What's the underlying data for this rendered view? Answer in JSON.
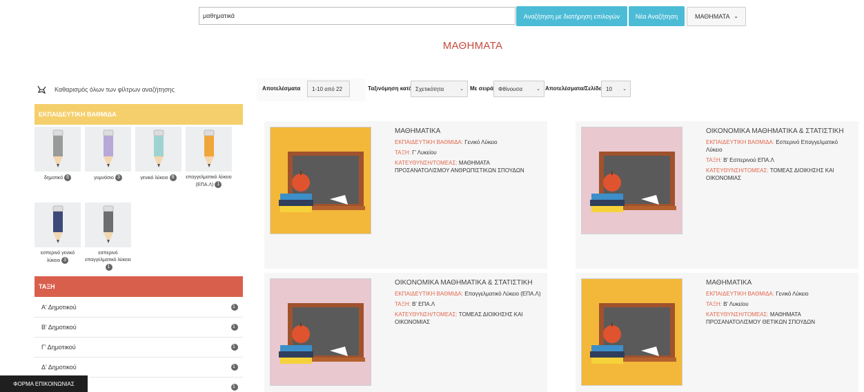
{
  "search": {
    "value": "μαθηματικά",
    "keep_options_label": "Αναζήτηση με διατήρηση επιλογών",
    "new_search_label": "Νέα Αναζήτηση",
    "category_selected": "ΜΑΘΗΜΑΤΑ"
  },
  "page_title": "ΜΑΘΗΜΑΤΑ",
  "sidebar": {
    "clear_filters_label": "Καθαρισμός όλων των φίλτρων αναζήτησης",
    "grade_panel_title": "ΕΚΠΑΙΔΕΥΤΙΚΗ ΒΑΘΜΙΔΑ",
    "grades": [
      {
        "label": "δημοτικό",
        "count": "6",
        "color": "#9a9a9a"
      },
      {
        "label": "γυμνάσιο",
        "count": "3",
        "color": "#b7a8d8"
      },
      {
        "label": "γενικό λύκειο",
        "count": "8",
        "color": "#9fd3cf"
      },
      {
        "label": "επαγγελματικό λύκειο (ΕΠΑ.Λ)",
        "count": "1",
        "color": "#f0a63a"
      },
      {
        "label": "εσπερινό γενικό λύκειο",
        "count": "3",
        "color": "#3d4a78"
      },
      {
        "label": "εσπερινό επαγγελματικό λύκειο",
        "count": "1",
        "color": "#6e6e6e"
      }
    ],
    "class_panel_title": "ΤΑΞΗ",
    "classes": [
      {
        "label": "Α' Δημοτικού",
        "count": "1"
      },
      {
        "label": "Β' Δημοτικού",
        "count": "1"
      },
      {
        "label": "Γ' Δημοτικού",
        "count": "1"
      },
      {
        "label": "Δ' Δημοτικού",
        "count": "1"
      },
      {
        "label": "",
        "count": "1"
      }
    ],
    "contact_label": "ΦΟΡΜΑ ΕΠΙΚΟΙΝΩΝΙΑΣ"
  },
  "toolbar": {
    "results_label": "Αποτελέσματα",
    "results_range": "1-10 από 22",
    "sort_label": "Ταξινόμηση κατά",
    "sort_value": "Σχετικότητα",
    "order_label": "Με σειρά",
    "order_value": "Φθίνουσα",
    "per_page_label": "Αποτελέσματα/Σελίδα",
    "per_page_value": "10"
  },
  "results": [
    {
      "title": "ΜΑΘΗΜΑΤΙΚΑ",
      "grade_label": "ΕΚΠΑΙΔΕΥΤΙΚΗ ΒΑΘΜΙΔΑ:",
      "grade_value": "Γενικό Λύκειο",
      "class_label": "ΤΑΞΗ:",
      "class_value": "Γ' Λυκείου",
      "dir_label": "ΚΑΤΕΥΘΥΝΣΗ/ΤΟΜΕΑΣ:",
      "dir_value": "ΜΑΘΗΜΑΤΑ ΠΡΟΣΑΝΑΤΟΛΙΣΜΟΥ ΑΝΘΡΩΠΙΣΤΙΚΩΝ ΣΠΟΥΔΩΝ",
      "bg": "#f3b839"
    },
    {
      "title": "ΟΙΚΟΝΟΜΙΚΑ ΜΑΘΗΜΑΤΙΚΑ & ΣΤΑΤΙΣΤΙΚΗ",
      "grade_label": "ΕΚΠΑΙΔΕΥΤΙΚΗ ΒΑΘΜΙΔΑ:",
      "grade_value": "Εσπερινό Επαγγελματικό Λύκειο",
      "class_label": "ΤΑΞΗ:",
      "class_value": "Β' Εσπερινού ΕΠΑ.Λ",
      "dir_label": "ΚΑΤΕΥΘΥΝΣΗ/ΤΟΜΕΑΣ:",
      "dir_value": "ΤΟΜΕΑΣ ΔΙΟΙΚΗΣΗΣ ΚΑΙ ΟΙΚΟΝΟΜΙΑΣ",
      "bg": "#e9c8cf"
    },
    {
      "title": "ΟΙΚΟΝΟΜΙΚΑ ΜΑΘΗΜΑΤΙΚΑ & ΣΤΑΤΙΣΤΙΚΗ",
      "grade_label": "ΕΚΠΑΙΔΕΥΤΙΚΗ ΒΑΘΜΙΔΑ:",
      "grade_value": "Επαγγελματικό Λύκειο (ΕΠΑ.Λ)",
      "class_label": "ΤΑΞΗ:",
      "class_value": "Β' ΕΠΑ.Λ",
      "dir_label": "ΚΑΤΕΥΘΥΝΣΗ/ΤΟΜΕΑΣ:",
      "dir_value": "ΤΟΜΕΑΣ ΔΙΟΙΚΗΣΗΣ ΚΑΙ ΟΙΚΟΝΟΜΙΑΣ",
      "bg": "#e9c8cf"
    },
    {
      "title": "ΜΑΘΗΜΑΤΙΚΑ",
      "grade_label": "ΕΚΠΑΙΔΕΥΤΙΚΗ ΒΑΘΜΙΔΑ:",
      "grade_value": "Γενικό Λύκειο",
      "class_label": "ΤΑΞΗ:",
      "class_value": "Β' Λυκείου",
      "dir_label": "ΚΑΤΕΥΘΥΝΣΗ/ΤΟΜΕΑΣ:",
      "dir_value": "ΜΑΘΗΜΑΤΑ ΠΡΟΣΑΝΑΤΟΛΙΣΜΟΥ ΘΕΤΙΚΩΝ ΣΠΟΥΔΩΝ",
      "bg": "#f3b839"
    }
  ]
}
